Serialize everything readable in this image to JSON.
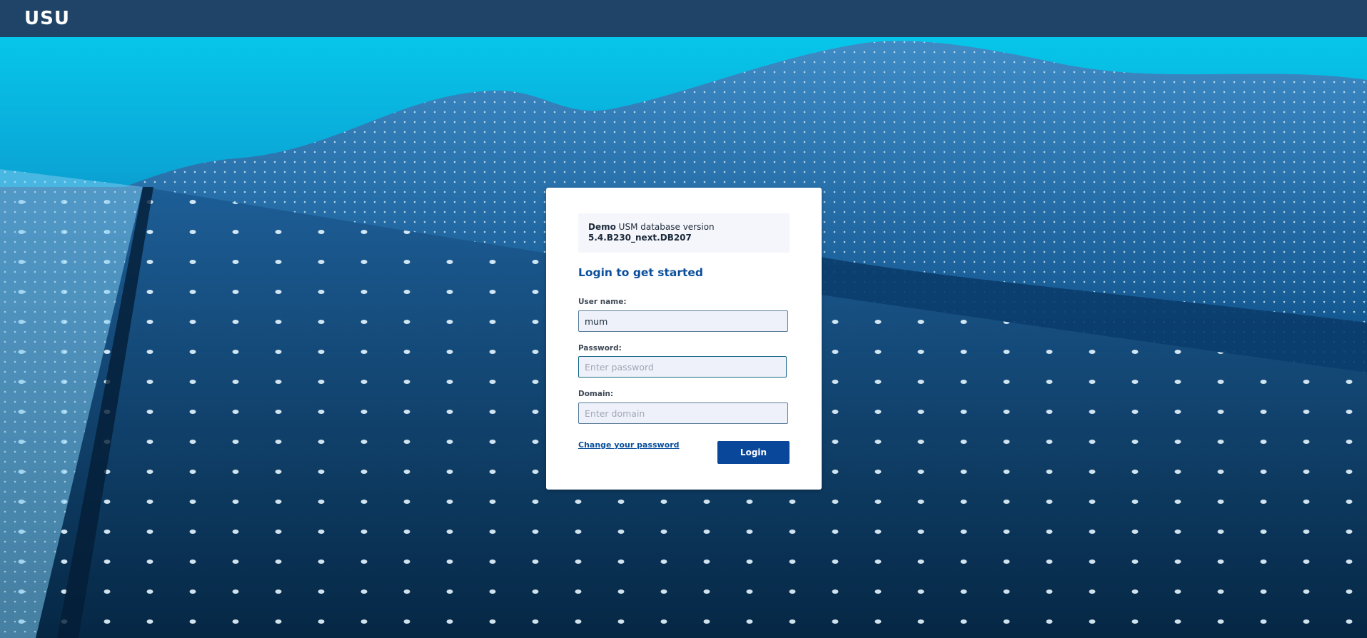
{
  "header": {
    "logo": "USU"
  },
  "info": {
    "edition": "Demo",
    "text": " USM database version",
    "version": "5.4.B230_next.DB207"
  },
  "login": {
    "heading": "Login to get started",
    "username_label": "User name:",
    "username_value": "mum",
    "password_label": "Password:",
    "password_placeholder": "Enter password",
    "domain_label": "Domain:",
    "domain_placeholder": "Enter domain",
    "change_password_link": "Change your password",
    "login_button": "Login"
  },
  "colors": {
    "topbar": "#1f4468",
    "accent": "#0b4f9c",
    "button": "#08479a"
  }
}
